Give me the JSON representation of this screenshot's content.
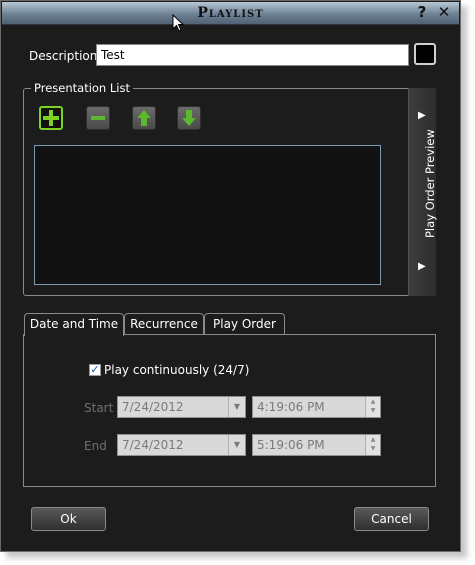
{
  "window": {
    "title": "Playlist",
    "help_label": "?",
    "close_label": "✕"
  },
  "description": {
    "label": "Description:",
    "value": "Test"
  },
  "presentation_list": {
    "group_title": "Presentation List",
    "icons": [
      "add-icon",
      "remove-icon",
      "move-up-icon",
      "move-down-icon"
    ],
    "side_panel_label": "Play Order Preview"
  },
  "tabs": [
    {
      "label": "Date and Time"
    },
    {
      "label": "Recurrence"
    },
    {
      "label": "Play Order"
    }
  ],
  "schedule": {
    "play_continuously_label": "Play continuously (24/7)",
    "play_continuously_checked": true,
    "start": {
      "label": "Start",
      "date": "7/24/2012",
      "time": "4:19:06 PM"
    },
    "end": {
      "label": "End",
      "date": "7/24/2012",
      "time": "5:19:06 PM"
    }
  },
  "buttons": {
    "ok_label": "Ok",
    "cancel_label": "Cancel"
  },
  "colors": {
    "accent_green": "#7ed321",
    "background": "#1c1c1c",
    "titlebar": "#6d8294"
  }
}
